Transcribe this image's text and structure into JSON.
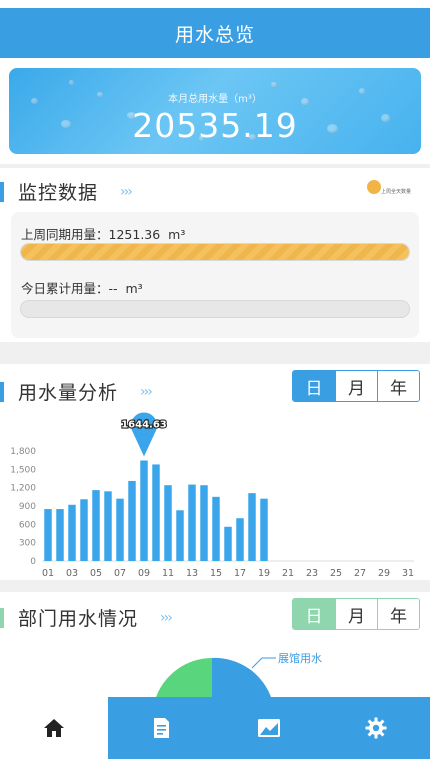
{
  "header": {
    "title": "用水总览"
  },
  "hero": {
    "label": "本月总用水量（m³）",
    "value": "20535.19"
  },
  "monitor": {
    "title": "监控数据",
    "arrows": "›››",
    "legend": {
      "label": "上周全天数量",
      "color": "#f3b447"
    },
    "last_week_label": "上周同期用量：",
    "last_week_value": "1251.36",
    "last_week_unit": "m³",
    "last_week_fill": 1.0,
    "today_label": "今日累计用量：",
    "today_value": "--",
    "today_unit": "m³",
    "today_fill": 0.0
  },
  "analysis": {
    "title": "用水量分析",
    "arrows": "›››",
    "tabs": [
      "日",
      "月",
      "年"
    ],
    "active_tab": 0
  },
  "chart_data": {
    "type": "bar",
    "categories": [
      "01",
      "02",
      "03",
      "04",
      "05",
      "06",
      "07",
      "08",
      "09",
      "10",
      "11",
      "12",
      "13",
      "14",
      "15",
      "16",
      "17",
      "18",
      "19",
      "20",
      "21",
      "22",
      "23",
      "24",
      "25",
      "26",
      "27",
      "28",
      "29",
      "30",
      "31"
    ],
    "x_tick_labels": [
      "01",
      "03",
      "05",
      "07",
      "09",
      "11",
      "13",
      "15",
      "17",
      "19",
      "21",
      "23",
      "25",
      "27",
      "29",
      "31"
    ],
    "values": [
      850,
      850,
      920,
      1010,
      1160,
      1140,
      1020,
      1310,
      1644.63,
      1580,
      1240,
      830,
      1250,
      1240,
      1050,
      560,
      700,
      1110,
      1020,
      null,
      null,
      null,
      null,
      null,
      null,
      null,
      null,
      null,
      null,
      null,
      null
    ],
    "y_ticks": [
      "0",
      "300",
      "600",
      "900",
      "1,200",
      "1,500",
      "1,800"
    ],
    "ylim": [
      0,
      1800
    ],
    "highlight": {
      "category": "09",
      "value": "1644.63"
    },
    "bar_color": "#3aa5ea"
  },
  "department": {
    "title": "部门用水情况",
    "arrows": "›››",
    "tabs": [
      "日",
      "月",
      "年"
    ],
    "active_tab": 0,
    "pie_label": "展馆用水",
    "colors": {
      "blue": "#3a9ee3",
      "green": "#59d67d"
    }
  },
  "nav": [
    {
      "name": "home-icon"
    },
    {
      "name": "document-icon"
    },
    {
      "name": "chart-icon"
    },
    {
      "name": "settings-icon"
    }
  ]
}
